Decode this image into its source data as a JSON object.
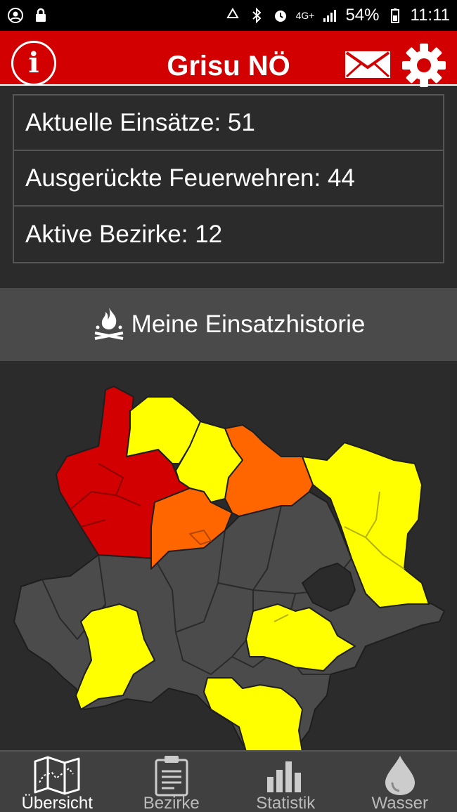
{
  "status_bar": {
    "battery": "54%",
    "time": "11:11",
    "network": "4G+"
  },
  "app_bar": {
    "title": "Grisu NÖ",
    "info_label": "i"
  },
  "stats": [
    {
      "label": "Aktuelle Einsätze: 51"
    },
    {
      "label": "Ausgerückte Feuerwehren: 44"
    },
    {
      "label": "Aktive Bezirke: 12"
    }
  ],
  "history_button": {
    "label": "Meine Einsatzhistorie"
  },
  "map": {
    "colors": {
      "inactive": "#4b4b4b",
      "low": "#ffff00",
      "medium": "#ff6600",
      "high": "#d20000",
      "border": "#1e1e1e"
    }
  },
  "nav": [
    {
      "label": "Übersicht",
      "icon": "map-icon",
      "active": true
    },
    {
      "label": "Bezirke",
      "icon": "clipboard-icon",
      "active": false
    },
    {
      "label": "Statistik",
      "icon": "bar-chart-icon",
      "active": false
    },
    {
      "label": "Wasser",
      "icon": "water-drop-icon",
      "active": false
    }
  ],
  "colors": {
    "brand": "#d20000",
    "background": "#2b2b2b"
  }
}
